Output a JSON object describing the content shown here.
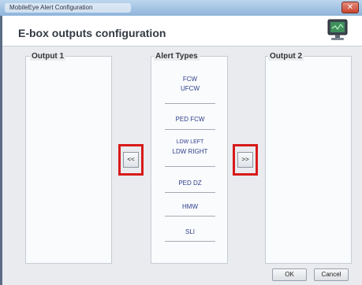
{
  "window": {
    "title": "MobileEye Alert Configuration",
    "close_glyph": "✕"
  },
  "header": {
    "title": "E-box outputs configuration",
    "icon": "monitor-icon"
  },
  "panels": {
    "output1_label": "Output 1",
    "alert_types_label": "Alert Types",
    "output2_label": "Output 2"
  },
  "alert_types": [
    {
      "lines": [
        "FCW",
        "UFCW"
      ]
    },
    {
      "lines": [
        "PED FCW"
      ]
    },
    {
      "lines": [
        "LDW LEFT",
        "LDW RIGHT"
      ]
    },
    {
      "lines": [
        "PED DZ"
      ]
    },
    {
      "lines": [
        "HMW"
      ]
    },
    {
      "lines": [
        "SLI"
      ]
    }
  ],
  "buttons": {
    "move_to_output1": "<<",
    "move_to_output2": ">>",
    "ok": "OK",
    "cancel": "Cancel"
  },
  "colors": {
    "highlight": "#d81a1a",
    "alert_text": "#2c3f8c"
  }
}
